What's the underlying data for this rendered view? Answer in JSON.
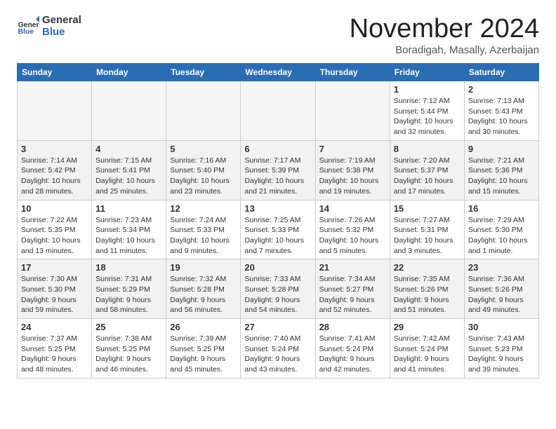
{
  "header": {
    "logo_general": "General",
    "logo_blue": "Blue",
    "title": "November 2024",
    "location": "Boradigah, Masally, Azerbaijan"
  },
  "weekdays": [
    "Sunday",
    "Monday",
    "Tuesday",
    "Wednesday",
    "Thursday",
    "Friday",
    "Saturday"
  ],
  "weeks": [
    [
      {
        "day": "",
        "info": ""
      },
      {
        "day": "",
        "info": ""
      },
      {
        "day": "",
        "info": ""
      },
      {
        "day": "",
        "info": ""
      },
      {
        "day": "",
        "info": ""
      },
      {
        "day": "1",
        "info": "Sunrise: 7:12 AM\nSunset: 5:44 PM\nDaylight: 10 hours\nand 32 minutes."
      },
      {
        "day": "2",
        "info": "Sunrise: 7:13 AM\nSunset: 5:43 PM\nDaylight: 10 hours\nand 30 minutes."
      }
    ],
    [
      {
        "day": "3",
        "info": "Sunrise: 7:14 AM\nSunset: 5:42 PM\nDaylight: 10 hours\nand 28 minutes."
      },
      {
        "day": "4",
        "info": "Sunrise: 7:15 AM\nSunset: 5:41 PM\nDaylight: 10 hours\nand 25 minutes."
      },
      {
        "day": "5",
        "info": "Sunrise: 7:16 AM\nSunset: 5:40 PM\nDaylight: 10 hours\nand 23 minutes."
      },
      {
        "day": "6",
        "info": "Sunrise: 7:17 AM\nSunset: 5:39 PM\nDaylight: 10 hours\nand 21 minutes."
      },
      {
        "day": "7",
        "info": "Sunrise: 7:19 AM\nSunset: 5:38 PM\nDaylight: 10 hours\nand 19 minutes."
      },
      {
        "day": "8",
        "info": "Sunrise: 7:20 AM\nSunset: 5:37 PM\nDaylight: 10 hours\nand 17 minutes."
      },
      {
        "day": "9",
        "info": "Sunrise: 7:21 AM\nSunset: 5:36 PM\nDaylight: 10 hours\nand 15 minutes."
      }
    ],
    [
      {
        "day": "10",
        "info": "Sunrise: 7:22 AM\nSunset: 5:35 PM\nDaylight: 10 hours\nand 13 minutes."
      },
      {
        "day": "11",
        "info": "Sunrise: 7:23 AM\nSunset: 5:34 PM\nDaylight: 10 hours\nand 11 minutes."
      },
      {
        "day": "12",
        "info": "Sunrise: 7:24 AM\nSunset: 5:33 PM\nDaylight: 10 hours\nand 9 minutes."
      },
      {
        "day": "13",
        "info": "Sunrise: 7:25 AM\nSunset: 5:33 PM\nDaylight: 10 hours\nand 7 minutes."
      },
      {
        "day": "14",
        "info": "Sunrise: 7:26 AM\nSunset: 5:32 PM\nDaylight: 10 hours\nand 5 minutes."
      },
      {
        "day": "15",
        "info": "Sunrise: 7:27 AM\nSunset: 5:31 PM\nDaylight: 10 hours\nand 3 minutes."
      },
      {
        "day": "16",
        "info": "Sunrise: 7:29 AM\nSunset: 5:30 PM\nDaylight: 10 hours\nand 1 minute."
      }
    ],
    [
      {
        "day": "17",
        "info": "Sunrise: 7:30 AM\nSunset: 5:30 PM\nDaylight: 9 hours\nand 59 minutes."
      },
      {
        "day": "18",
        "info": "Sunrise: 7:31 AM\nSunset: 5:29 PM\nDaylight: 9 hours\nand 58 minutes."
      },
      {
        "day": "19",
        "info": "Sunrise: 7:32 AM\nSunset: 5:28 PM\nDaylight: 9 hours\nand 56 minutes."
      },
      {
        "day": "20",
        "info": "Sunrise: 7:33 AM\nSunset: 5:28 PM\nDaylight: 9 hours\nand 54 minutes."
      },
      {
        "day": "21",
        "info": "Sunrise: 7:34 AM\nSunset: 5:27 PM\nDaylight: 9 hours\nand 52 minutes."
      },
      {
        "day": "22",
        "info": "Sunrise: 7:35 AM\nSunset: 5:26 PM\nDaylight: 9 hours\nand 51 minutes."
      },
      {
        "day": "23",
        "info": "Sunrise: 7:36 AM\nSunset: 5:26 PM\nDaylight: 9 hours\nand 49 minutes."
      }
    ],
    [
      {
        "day": "24",
        "info": "Sunrise: 7:37 AM\nSunset: 5:25 PM\nDaylight: 9 hours\nand 48 minutes."
      },
      {
        "day": "25",
        "info": "Sunrise: 7:38 AM\nSunset: 5:25 PM\nDaylight: 9 hours\nand 46 minutes."
      },
      {
        "day": "26",
        "info": "Sunrise: 7:39 AM\nSunset: 5:25 PM\nDaylight: 9 hours\nand 45 minutes."
      },
      {
        "day": "27",
        "info": "Sunrise: 7:40 AM\nSunset: 5:24 PM\nDaylight: 9 hours\nand 43 minutes."
      },
      {
        "day": "28",
        "info": "Sunrise: 7:41 AM\nSunset: 5:24 PM\nDaylight: 9 hours\nand 42 minutes."
      },
      {
        "day": "29",
        "info": "Sunrise: 7:42 AM\nSunset: 5:24 PM\nDaylight: 9 hours\nand 41 minutes."
      },
      {
        "day": "30",
        "info": "Sunrise: 7:43 AM\nSunset: 5:23 PM\nDaylight: 9 hours\nand 39 minutes."
      }
    ]
  ],
  "row_backgrounds": [
    "#ffffff",
    "#f2f2f2",
    "#ffffff",
    "#f2f2f2",
    "#ffffff"
  ]
}
